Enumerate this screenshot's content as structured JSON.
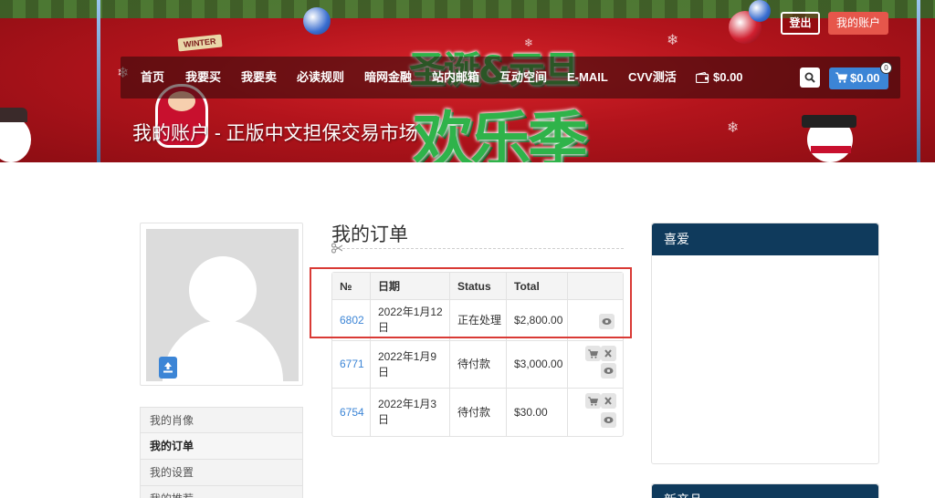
{
  "header": {
    "logout_label": "登出",
    "account_label": "我的账户",
    "banner_promo_top": "圣诞&元旦",
    "banner_promo_main": "欢乐季",
    "banner_sign": "WINTER",
    "page_title": "我的账户 - 正版中文担保交易市场"
  },
  "nav": {
    "items": [
      {
        "label": "首页"
      },
      {
        "label": "我要买"
      },
      {
        "label": "我要卖"
      },
      {
        "label": "必读规则"
      },
      {
        "label": "暗网金融"
      },
      {
        "label": "站内邮箱"
      },
      {
        "label": "互动空间"
      },
      {
        "label": "E-MAIL"
      },
      {
        "label": "CVV测活"
      }
    ],
    "wallet_amount": "$0.00",
    "cart_amount": "$0.00",
    "cart_count": "0"
  },
  "sidebar": {
    "items": [
      {
        "label": "我的肖像",
        "active": false
      },
      {
        "label": "我的订单",
        "active": true
      },
      {
        "label": "我的设置",
        "active": false
      },
      {
        "label": "我的推荐",
        "active": false
      }
    ]
  },
  "orders": {
    "title": "我的订单",
    "headers": [
      "№",
      "日期",
      "Status",
      "Total",
      ""
    ],
    "rows": [
      {
        "id": "6802",
        "date_line1": "2022年1月12",
        "date_line2": "日",
        "status": "正在处理",
        "total": "$2,800.00",
        "actions": [
          "view"
        ]
      },
      {
        "id": "6771",
        "date_line1": "2022年1月9",
        "date_line2": "日",
        "status": "待付款",
        "total": "$3,000.00",
        "actions": [
          "pay",
          "cancel",
          "view"
        ]
      },
      {
        "id": "6754",
        "date_line1": "2022年1月3",
        "date_line2": "日",
        "status": "待付款",
        "total": "$30.00",
        "actions": [
          "pay",
          "cancel",
          "view"
        ]
      }
    ]
  },
  "widgets": {
    "favorites_title": "喜爱",
    "new_products_title": "新产品"
  },
  "colors": {
    "accent_blue": "#3c85d6",
    "widget_header": "#0f3a5c",
    "account_button": "#e6564b",
    "highlight_border": "#d93a35"
  }
}
